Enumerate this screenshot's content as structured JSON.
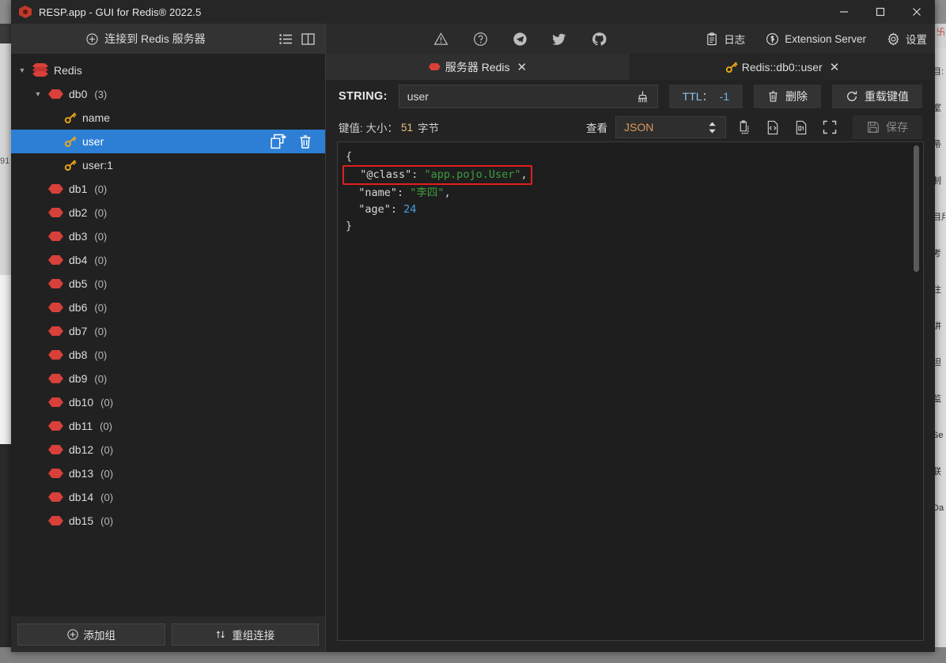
{
  "window": {
    "title": "RESP.app - GUI for Redis® 2022.5",
    "minimize": "–",
    "maximize": "□",
    "close": "✕"
  },
  "sidebar": {
    "connect_label": "连接到 Redis 服务器",
    "connect_icon": "plus-circle-icon",
    "list_icon": "list-view-icon",
    "panel_icon": "split-panel-icon",
    "tree": [
      {
        "label": "Redis",
        "count": "",
        "depth": 0,
        "icon": "redis-stack-icon",
        "caret": "▼",
        "selected": false
      },
      {
        "label": "db0",
        "count": "(3)",
        "depth": 1,
        "icon": "database-icon",
        "caret": "▼",
        "selected": false
      },
      {
        "label": "name",
        "count": "",
        "depth": 2,
        "icon": "key-icon",
        "caret": "",
        "selected": false
      },
      {
        "label": "user",
        "count": "",
        "depth": 2,
        "icon": "key-icon",
        "caret": "",
        "selected": true
      },
      {
        "label": "user:1",
        "count": "",
        "depth": 2,
        "icon": "key-icon",
        "caret": "",
        "selected": false
      },
      {
        "label": "db1",
        "count": "(0)",
        "depth": 1,
        "icon": "database-icon",
        "caret": "",
        "selected": false
      },
      {
        "label": "db2",
        "count": "(0)",
        "depth": 1,
        "icon": "database-icon",
        "caret": "",
        "selected": false
      },
      {
        "label": "db3",
        "count": "(0)",
        "depth": 1,
        "icon": "database-icon",
        "caret": "",
        "selected": false
      },
      {
        "label": "db4",
        "count": "(0)",
        "depth": 1,
        "icon": "database-icon",
        "caret": "",
        "selected": false
      },
      {
        "label": "db5",
        "count": "(0)",
        "depth": 1,
        "icon": "database-icon",
        "caret": "",
        "selected": false
      },
      {
        "label": "db6",
        "count": "(0)",
        "depth": 1,
        "icon": "database-icon",
        "caret": "",
        "selected": false
      },
      {
        "label": "db7",
        "count": "(0)",
        "depth": 1,
        "icon": "database-icon",
        "caret": "",
        "selected": false
      },
      {
        "label": "db8",
        "count": "(0)",
        "depth": 1,
        "icon": "database-icon",
        "caret": "",
        "selected": false
      },
      {
        "label": "db9",
        "count": "(0)",
        "depth": 1,
        "icon": "database-icon",
        "caret": "",
        "selected": false
      },
      {
        "label": "db10",
        "count": "(0)",
        "depth": 1,
        "icon": "database-icon",
        "caret": "",
        "selected": false
      },
      {
        "label": "db11",
        "count": "(0)",
        "depth": 1,
        "icon": "database-icon",
        "caret": "",
        "selected": false
      },
      {
        "label": "db12",
        "count": "(0)",
        "depth": 1,
        "icon": "database-icon",
        "caret": "",
        "selected": false
      },
      {
        "label": "db13",
        "count": "(0)",
        "depth": 1,
        "icon": "database-icon",
        "caret": "",
        "selected": false
      },
      {
        "label": "db14",
        "count": "(0)",
        "depth": 1,
        "icon": "database-icon",
        "caret": "",
        "selected": false
      },
      {
        "label": "db15",
        "count": "(0)",
        "depth": 1,
        "icon": "database-icon",
        "caret": "",
        "selected": false
      }
    ],
    "row_actions": {
      "copy_icon": "copy-key-icon",
      "delete_icon": "trash-icon"
    },
    "footer": {
      "add_group_label": "添加组",
      "add_group_icon": "plus-circle-icon",
      "reorder_label": "重组连接",
      "reorder_icon": "sort-arrows-icon"
    }
  },
  "toolbar": {
    "center_icons": [
      "warning-triangle-icon",
      "question-circle-icon",
      "telegram-icon",
      "twitter-icon",
      "github-icon"
    ],
    "log_label": "日志",
    "log_icon": "clipboard-icon",
    "extension_label": "Extension Server",
    "extension_icon": "extension-icon",
    "settings_label": "设置",
    "settings_icon": "gear-icon"
  },
  "tabs": [
    {
      "label": "服务器 Redis",
      "icon": "database-icon",
      "close": "✕",
      "active": true
    },
    {
      "label": "Redis::db0::user",
      "icon": "key-icon",
      "close": "✕",
      "active": false
    }
  ],
  "keybar": {
    "type_label": "STRING:",
    "key_value": "user",
    "key_placeholder": "",
    "clear_icon": "broom-icon",
    "ttl_label": "TTL：",
    "ttl_value": "-1",
    "delete_label": "删除",
    "delete_icon": "trash-icon",
    "reload_label": "重载键值",
    "reload_icon": "refresh-icon"
  },
  "metabar": {
    "size_prefix": "键值: 大小：",
    "size_value": "51",
    "size_unit": "字节",
    "view_label": "查看",
    "view_format": "JSON",
    "stepper_icon": "updown-chevron-icon",
    "action_icons": [
      "copy-to-clipboard-icon",
      "format-code-icon",
      "save-to-file-icon",
      "fullscreen-icon"
    ],
    "save_label": "保存",
    "save_icon": "floppy-disk-icon"
  },
  "editor": {
    "lines": [
      {
        "segments": [
          {
            "text": "{",
            "cls": "j-pun"
          }
        ],
        "highlight": false
      },
      {
        "segments": [
          {
            "text": "  \"@class\"",
            "cls": "j-key"
          },
          {
            "text": ": ",
            "cls": "j-pun"
          },
          {
            "text": "\"app.pojo.User\"",
            "cls": "j-str"
          },
          {
            "text": ",",
            "cls": "j-pun"
          }
        ],
        "highlight": true
      },
      {
        "segments": [
          {
            "text": "  \"name\"",
            "cls": "j-key"
          },
          {
            "text": ": ",
            "cls": "j-pun"
          },
          {
            "text": "\"李四\"",
            "cls": "j-str"
          },
          {
            "text": ",",
            "cls": "j-pun"
          }
        ],
        "highlight": false
      },
      {
        "segments": [
          {
            "text": "  \"age\"",
            "cls": "j-key"
          },
          {
            "text": ": ",
            "cls": "j-pun"
          },
          {
            "text": "24",
            "cls": "j-num"
          }
        ],
        "highlight": false
      },
      {
        "segments": [
          {
            "text": "}",
            "cls": "j-pun"
          }
        ],
        "highlight": false
      }
    ],
    "highlight_color": "#e31e1e"
  },
  "background": {
    "right_strip_text": [
      "目:",
      "室",
      "帚",
      "制",
      "目用",
      "考",
      "注",
      "讲",
      "坦",
      "监",
      "Se",
      "联",
      "Da"
    ],
    "left_number": "91"
  }
}
